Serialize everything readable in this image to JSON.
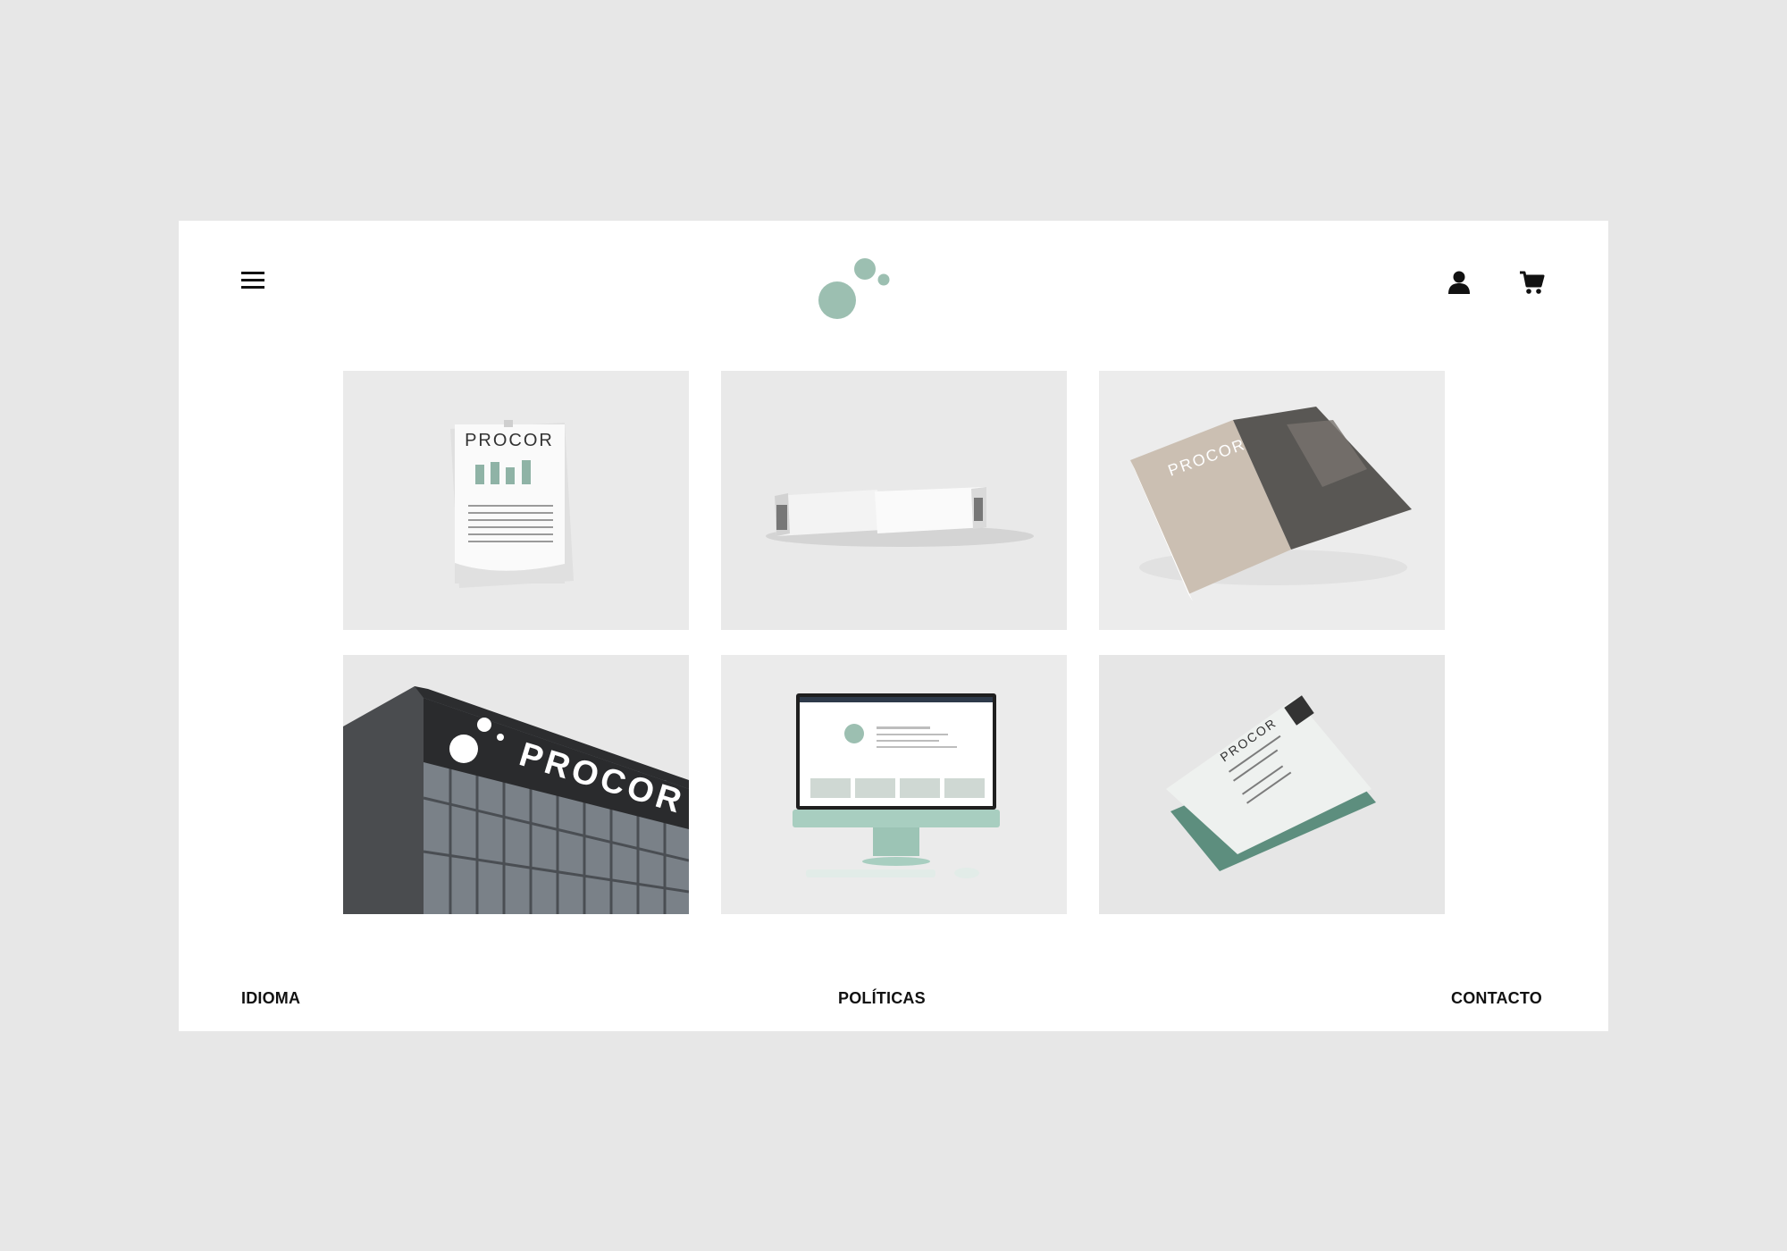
{
  "header": {
    "menu_icon": "hamburger-menu-icon",
    "user_icon": "user-icon",
    "cart_icon": "shopping-cart-icon"
  },
  "brand": {
    "primary_color": "#9cbfb1",
    "name": "PROCOR"
  },
  "gallery": [
    {
      "name": "calendar-mockup",
      "caption": "PROCOR"
    },
    {
      "name": "boxes-mockup",
      "caption": ""
    },
    {
      "name": "brochure-mockup",
      "caption": "PROCOR"
    },
    {
      "name": "building-sign-mockup",
      "caption": "PROCOR"
    },
    {
      "name": "desktop-mockup",
      "caption": ""
    },
    {
      "name": "business-card-mockup",
      "caption": "PROCOR"
    }
  ],
  "footer": {
    "idioma": "IDIOMA",
    "politicas": "POLÍTICAS",
    "contacto": "CONTACTO"
  }
}
